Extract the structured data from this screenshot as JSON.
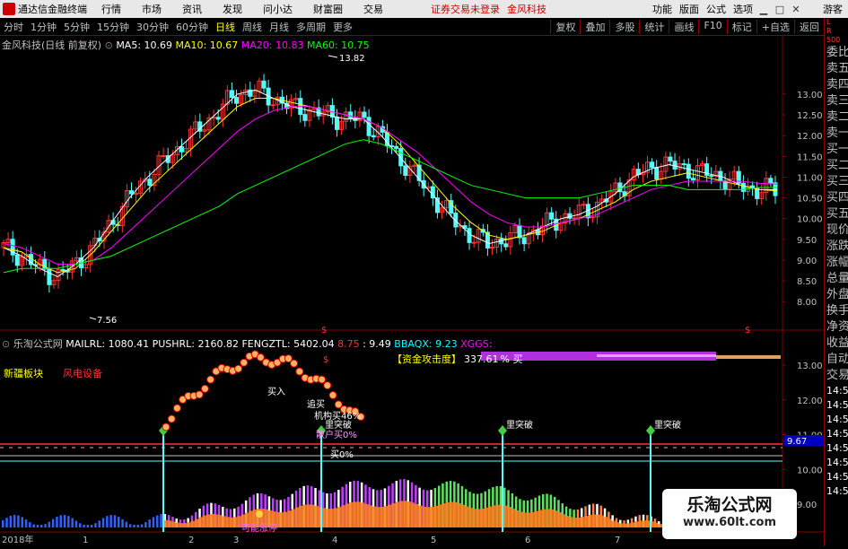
{
  "topbar": {
    "app_name": "通达信金融终端",
    "menus": [
      "行情",
      "市场",
      "资讯",
      "发现",
      "问小达",
      "财富圈",
      "交易"
    ],
    "alert": "证券交易未登录",
    "stock_name": "金风科技",
    "right_menus": [
      "功能",
      "版面",
      "公式",
      "选项"
    ],
    "guest": "游客"
  },
  "toolbar": {
    "periods": [
      "分时",
      "1分钟",
      "5分钟",
      "15分钟",
      "30分钟",
      "60分钟",
      "日线",
      "周线",
      "月线",
      "多周期",
      "更多"
    ],
    "active": "日线",
    "right": [
      "复权",
      "叠加",
      "多股",
      "统计",
      "画线",
      "F10",
      "标记",
      "+自选",
      "返回"
    ]
  },
  "side": {
    "corner": [
      "L",
      "R",
      "500"
    ],
    "items": [
      "委比",
      "卖五",
      "卖四",
      "卖三",
      "卖二",
      "卖一",
      "买一",
      "买二",
      "买三",
      "买四",
      "买五",
      "现价",
      "涨跌",
      "涨幅",
      "总量",
      "外盘",
      "换手",
      "净资",
      "收益",
      "自动",
      "交易",
      "14:56",
      "14:56",
      "14:56",
      "14:56",
      "14:56",
      "14:56",
      "14:56",
      "14:56"
    ]
  },
  "main_chart": {
    "title": "金风科技(日线 前复权)",
    "ma": [
      {
        "label": "MA5: 10.69",
        "color": "#ffffff"
      },
      {
        "label": "MA10: 10.67",
        "color": "#ffff00"
      },
      {
        "label": "MA20: 10.83",
        "color": "#ff00ff"
      },
      {
        "label": "MA60: 10.75",
        "color": "#00ff00"
      }
    ],
    "high_label": "13.82",
    "low_label": "7.56",
    "yticks": [
      "13.00",
      "12.50",
      "12.00",
      "11.50",
      "11.00",
      "10.50",
      "10.00",
      "9.50",
      "9.00",
      "8.50",
      "8.00"
    ]
  },
  "sub_chart": {
    "title": "乐淘公式网",
    "values": [
      {
        "label": "MAILRL: 1080.41",
        "color": "#ffffff"
      },
      {
        "label": "PUSHRL: 2160.82",
        "color": "#ffffff"
      },
      {
        "label": "FENGZTL: 5402.04",
        "color": "#ffffff"
      },
      {
        "label": "8.75",
        "color": "#ff3333"
      },
      {
        "label": ": 9.49",
        "color": "#ffffff"
      },
      {
        "label": "BBAQX: 9.23",
        "color": "#00ffff"
      },
      {
        "label": "XGGS:",
        "color": "#ff00ff"
      }
    ],
    "sector": "新疆板块",
    "concept": "风电设备",
    "fund_label": "【资金攻击度】",
    "fund_value": "337.61",
    "fund_pct": "% 买",
    "annotations": [
      "追买",
      "机构买46%",
      "散户买0%",
      "买入",
      "买0%"
    ],
    "breakout": "里突破",
    "may_limit": "可能涨停",
    "level": "9.67",
    "yticks": [
      "13.00",
      "12.00",
      "11.00",
      "10.00",
      "9.00"
    ]
  },
  "xaxis": [
    "2018年",
    "1",
    "2",
    "3",
    "4",
    "5",
    "6",
    "7"
  ],
  "watermark": {
    "line1": "乐淘公式网",
    "line2": "www.60lt.com"
  },
  "colors": {
    "up": "#ff3333",
    "down": "#54fcfc",
    "ma5": "#ffffff",
    "ma10": "#ffff00",
    "ma20": "#ff00ff",
    "ma60": "#00ff00",
    "grid": "#800000"
  },
  "chart_data": {
    "type": "line",
    "title": "",
    "x": [
      0,
      4,
      8,
      12,
      16,
      20,
      24,
      28,
      32,
      36,
      40,
      44,
      48,
      52,
      56,
      60,
      64,
      68,
      72,
      76,
      80,
      84,
      88,
      92,
      96,
      100,
      104,
      108,
      112,
      116,
      120,
      124,
      128,
      132,
      136,
      140,
      144,
      148,
      152,
      156,
      160,
      164,
      168,
      172
    ],
    "series": [
      {
        "name": "MA5",
        "values": [
          9.3,
          9.1,
          8.8,
          8.6,
          8.9,
          9.3,
          9.9,
          10.5,
          11.0,
          11.4,
          11.8,
          12.2,
          12.6,
          13.0,
          13.1,
          12.9,
          12.7,
          12.6,
          12.5,
          12.4,
          12.4,
          12.0,
          11.5,
          11.0,
          10.5,
          10.0,
          9.6,
          9.4,
          9.5,
          9.6,
          9.8,
          10.0,
          10.1,
          10.3,
          10.6,
          11.0,
          11.2,
          11.3,
          11.2,
          11.1,
          11.0,
          10.8,
          10.7,
          10.7
        ]
      },
      {
        "name": "MA10",
        "values": [
          9.3,
          9.2,
          8.9,
          8.7,
          8.8,
          9.2,
          9.7,
          10.2,
          10.7,
          11.1,
          11.5,
          11.9,
          12.3,
          12.7,
          12.9,
          12.9,
          12.8,
          12.7,
          12.6,
          12.5,
          12.4,
          12.2,
          11.8,
          11.3,
          10.8,
          10.3,
          9.9,
          9.6,
          9.5,
          9.6,
          9.7,
          9.9,
          10.0,
          10.2,
          10.4,
          10.7,
          10.9,
          11.0,
          11.1,
          11.0,
          10.9,
          10.8,
          10.7,
          10.67
        ]
      },
      {
        "name": "MA20",
        "values": [
          9.4,
          9.3,
          9.1,
          8.9,
          8.9,
          9.0,
          9.3,
          9.7,
          10.1,
          10.5,
          10.9,
          11.3,
          11.7,
          12.1,
          12.4,
          12.6,
          12.7,
          12.7,
          12.6,
          12.5,
          12.4,
          12.2,
          11.9,
          11.6,
          11.2,
          10.8,
          10.4,
          10.1,
          9.9,
          9.8,
          9.8,
          9.9,
          10.0,
          10.1,
          10.3,
          10.5,
          10.7,
          10.8,
          10.9,
          10.9,
          10.9,
          10.9,
          10.85,
          10.83
        ]
      },
      {
        "name": "MA60",
        "values": [
          8.7,
          8.8,
          8.8,
          8.8,
          8.9,
          9.0,
          9.1,
          9.3,
          9.5,
          9.7,
          9.9,
          10.1,
          10.3,
          10.6,
          10.8,
          11.0,
          11.2,
          11.4,
          11.6,
          11.8,
          11.9,
          11.8,
          11.6,
          11.4,
          11.2,
          11.0,
          10.8,
          10.7,
          10.6,
          10.5,
          10.5,
          10.5,
          10.5,
          10.6,
          10.7,
          10.8,
          10.8,
          10.8,
          10.7,
          10.7,
          10.7,
          10.7,
          10.75,
          10.75
        ]
      }
    ],
    "ylim": [
      7.4,
      14.1
    ],
    "grid": false,
    "legend": "top-left"
  }
}
